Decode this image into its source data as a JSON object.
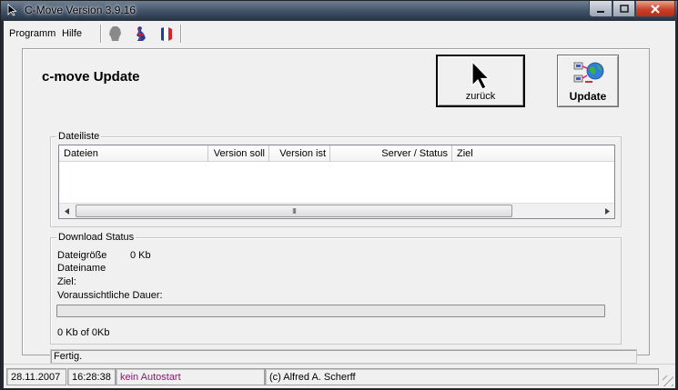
{
  "window": {
    "title": "C-Move Version 3.9.16"
  },
  "menu": {
    "programm": "Programm",
    "hilfe": "Hilfe"
  },
  "toolbar": {
    "icons": [
      "germany-flag-icon",
      "uk-flag-icon",
      "france-flag-icon"
    ]
  },
  "page": {
    "title": "c-move Update"
  },
  "buttons": {
    "back_label": "zurück",
    "update_label": "Update"
  },
  "file_list": {
    "legend": "Dateiliste",
    "columns": [
      "Dateien",
      "Version soll",
      "Version ist",
      "Server / Status",
      "Ziel"
    ],
    "scroll_thumb": "III"
  },
  "download": {
    "legend": "Download Status",
    "size_label": "Dateigröße",
    "size_value": "0 Kb",
    "name_label": "Dateiname",
    "target_label": "Ziel:",
    "duration_label": "Voraussichtliche Dauer:",
    "progress": 0,
    "transferred": "0 Kb of 0Kb"
  },
  "status_message": "Fertig.",
  "statusbar": {
    "date": "28.11.2007",
    "time": "16:28:38",
    "autostart": "kein Autostart",
    "copyright": "(c) Alfred A. Scherff"
  },
  "colors": {
    "autostart_text": "#8b1a6b",
    "close_button": "#c7432a"
  }
}
